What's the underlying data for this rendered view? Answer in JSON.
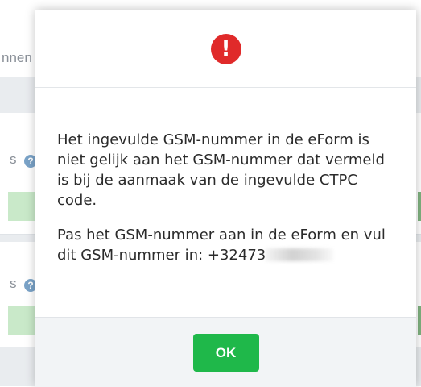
{
  "background": {
    "partial_text_top": "nnen",
    "partial_text_mid1": "s",
    "partial_text_mid2": "s",
    "help_icon": "question-circle-icon"
  },
  "modal": {
    "icon": "exclamation-circle-icon",
    "icon_color": "#e02a2a",
    "paragraph1": "Het ingevulde GSM-nummer in de eForm is niet gelijk aan het GSM-nummer dat vermeld is bij de aanmaak van de ingevulde CTPC code.",
    "paragraph2_prefix": "Pas het GSM-nummer aan in de eForm en vul dit GSM-nummer in: +32473",
    "ok_label": "OK",
    "ok_color": "#1fb84a"
  }
}
